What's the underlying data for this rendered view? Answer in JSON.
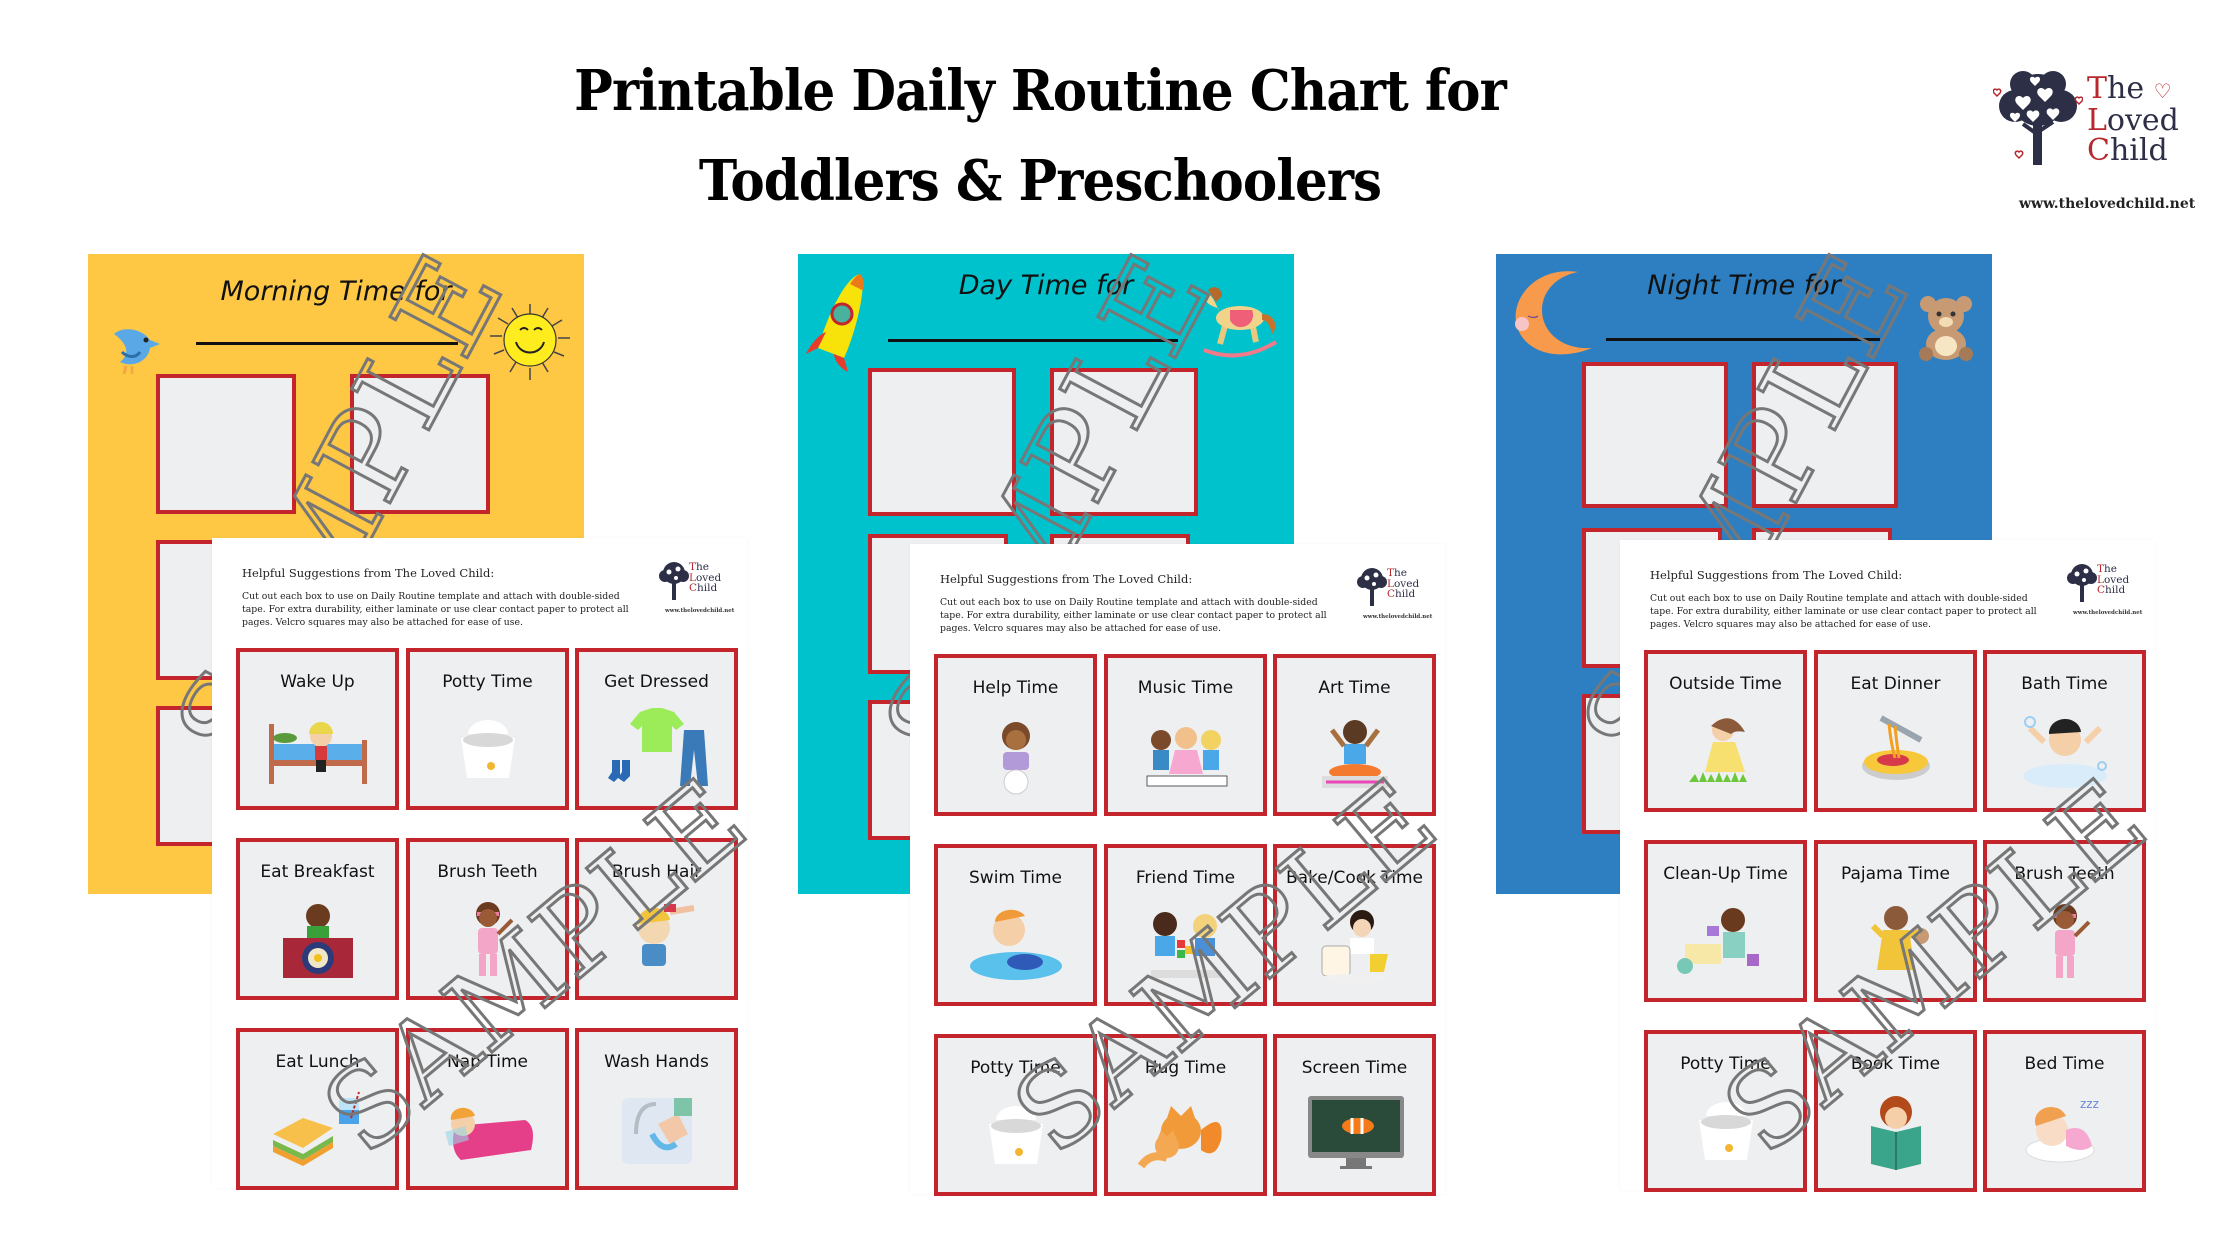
{
  "page": {
    "title_line1": "Printable Daily Routine Chart for",
    "title_line2": "Toddlers & Preschoolers"
  },
  "brand": {
    "name_line1_initial": "T",
    "name_line1_rest": "he",
    "name_line2_initial": "L",
    "name_line2_rest": "oved",
    "name_line3_initial": "C",
    "name_line3_rest": "hild",
    "url": "www.thelovedchild.net",
    "colors": {
      "navy": "#2d2f47",
      "red": "#b7282e"
    }
  },
  "watermark": "SAMPLE",
  "helpful": {
    "title": "Helpful Suggestions from The Loved Child:",
    "body": "Cut out each box to use on Daily Routine template and attach with double-sided tape. For extra durability, either laminate or use clear contact paper to protect all pages. Velcro squares may also be attached for ease of use.",
    "mini_url": "www.thelovedchild.net"
  },
  "templates": [
    {
      "heading": "Morning Time for",
      "color": "#fec845",
      "decor_left": "bird-icon",
      "decor_right": "sun-icon"
    },
    {
      "heading": "Day Time for",
      "color": "#00c2cc",
      "decor_left": "rocket-icon",
      "decor_right": "rocking-horse-icon"
    },
    {
      "heading": "Night Time for",
      "color": "#2d7fc1",
      "decor_left": "moon-icon",
      "decor_right": "teddy-bear-icon"
    }
  ],
  "card_sets": [
    {
      "name": "morning",
      "cards": [
        {
          "label": "Wake Up",
          "icon": "bed-icon"
        },
        {
          "label": "Potty Time",
          "icon": "potty-icon"
        },
        {
          "label": "Get Dressed",
          "icon": "clothes-icon"
        },
        {
          "label": "Eat Breakfast",
          "icon": "breakfast-icon"
        },
        {
          "label": "Brush Teeth",
          "icon": "toothbrush-icon"
        },
        {
          "label": "Brush Hair",
          "icon": "hairbrush-icon"
        },
        {
          "label": "Eat Lunch",
          "icon": "sandwich-icon"
        },
        {
          "label": "Nap Time",
          "icon": "sleeping-bag-icon"
        },
        {
          "label": "Wash Hands",
          "icon": "wash-hands-icon"
        }
      ]
    },
    {
      "name": "day",
      "cards": [
        {
          "label": "Help Time",
          "icon": "helper-icon"
        },
        {
          "label": "Music Time",
          "icon": "music-icon"
        },
        {
          "label": "Art Time",
          "icon": "paint-icon"
        },
        {
          "label": "Swim Time",
          "icon": "swim-icon"
        },
        {
          "label": "Friend Time",
          "icon": "friends-icon"
        },
        {
          "label": "Bake/Cook Time",
          "icon": "cook-icon"
        },
        {
          "label": "Potty Time",
          "icon": "potty-icon"
        },
        {
          "label": "Hug Time",
          "icon": "fox-hug-icon"
        },
        {
          "label": "Screen Time",
          "icon": "monitor-icon"
        }
      ]
    },
    {
      "name": "night",
      "cards": [
        {
          "label": "Outside Time",
          "icon": "outside-icon"
        },
        {
          "label": "Eat Dinner",
          "icon": "spaghetti-icon"
        },
        {
          "label": "Bath Time",
          "icon": "bath-icon"
        },
        {
          "label": "Clean-Up Time",
          "icon": "toys-icon"
        },
        {
          "label": "Pajama Time",
          "icon": "pajama-icon"
        },
        {
          "label": "Brush Teeth",
          "icon": "toothbrush-icon"
        },
        {
          "label": "Potty Time",
          "icon": "potty-icon"
        },
        {
          "label": "Book Time",
          "icon": "book-icon"
        },
        {
          "label": "Bed Time",
          "icon": "sleeping-baby-icon"
        }
      ]
    }
  ],
  "colors": {
    "card_border": "#c4242b",
    "card_fill": "#eeeff1"
  }
}
